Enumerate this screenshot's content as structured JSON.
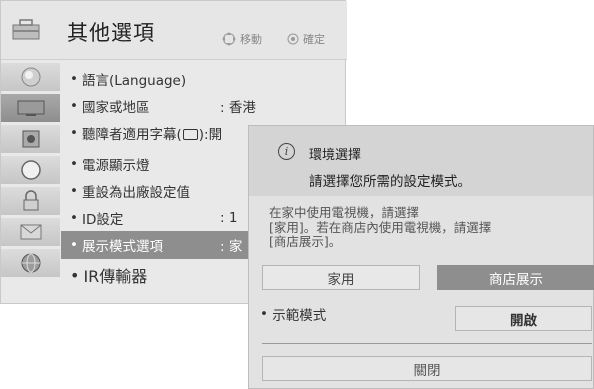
{
  "menu": {
    "title": "其他選項",
    "hint_move": "移動",
    "hint_ok": "確定",
    "items": [
      {
        "label": "語言(Language)",
        "value": ""
      },
      {
        "label": "國家或地區",
        "value": ": 香港"
      },
      {
        "label_pre": "聽障者適用字幕(",
        "label_post": "):開",
        "value": ""
      },
      {
        "label": "電源顯示燈",
        "value": ""
      },
      {
        "label": "重設為出廠設定值",
        "value": ""
      },
      {
        "label": "ID設定",
        "value": ": 1"
      },
      {
        "label": "展示模式選項",
        "value": ": 家"
      },
      {
        "label": "IR傳輸器",
        "value": ""
      }
    ],
    "categories": [
      "picture-icon",
      "tv-screen-icon",
      "speaker-icon",
      "clock-icon",
      "lock-icon",
      "envelope-icon",
      "globe-icon"
    ]
  },
  "dialog": {
    "title": "環境選擇",
    "subtitle": "請選擇您所需的設定模式。",
    "desc_lines": [
      "在家中使用電視機，請選擇",
      "[家用]。若在商店內使用電視機，請選擇",
      "[商店展示]。"
    ],
    "home_button": "家用",
    "store_button": "商店展示",
    "demo_label": "示範模式",
    "demo_value": "開啟",
    "close_button": "關閉"
  },
  "colors": {
    "selected": "#8e8e8e",
    "menu_bg": "#e9e9e9",
    "dialog_bg": "#e2e2e2",
    "dialog_header": "#d4d4d4"
  }
}
